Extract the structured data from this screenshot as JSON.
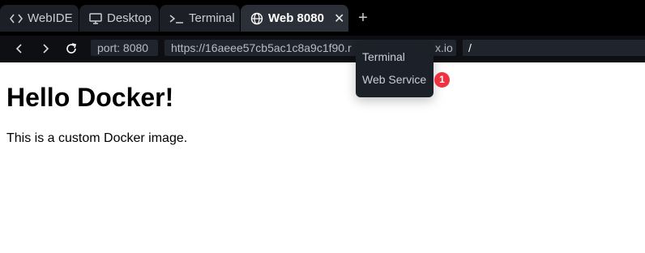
{
  "tabs": [
    {
      "label": "WebIDE",
      "icon": "code-icon"
    },
    {
      "label": "Desktop",
      "icon": "monitor-icon"
    },
    {
      "label": "Terminal",
      "icon": "terminal-icon"
    },
    {
      "label": "Web 8080",
      "icon": "globe-icon",
      "active": true,
      "close": "✕"
    }
  ],
  "new_tab_label": "+",
  "nav": {
    "port": "port: 8080",
    "url": "https://16aeee57cb5ac1c8a9c1f90.r",
    "url_suffix": "x.io",
    "path": "/"
  },
  "menu": {
    "items": [
      "Terminal",
      "Web Service"
    ]
  },
  "badge": "1",
  "page": {
    "heading": "Hello Docker!",
    "paragraph": "This is a custom Docker image."
  },
  "colors": {
    "tabbar_bg": "#000000",
    "active_tab_bg": "#2b2f38",
    "menu_bg": "#1c2029",
    "badge_red": "#f0313f"
  }
}
